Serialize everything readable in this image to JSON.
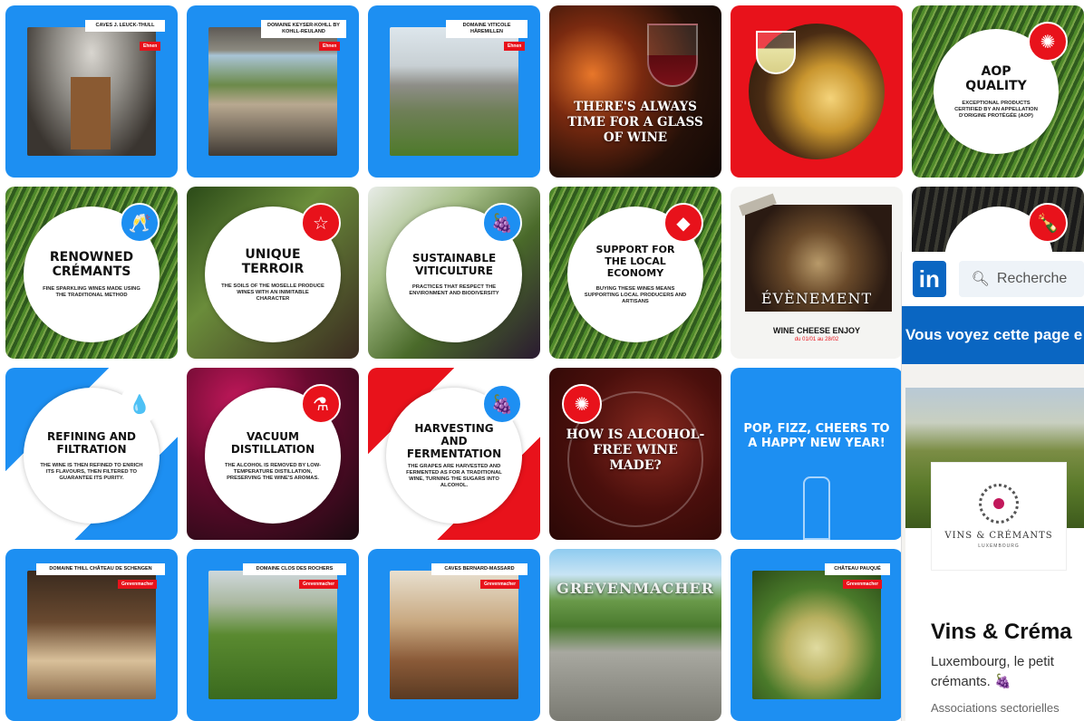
{
  "row1": {
    "t1": {
      "label": "CAVES J. LEUCK-THULL",
      "loc": "Ehnen"
    },
    "t2": {
      "label": "DOMAINE KEYSER-KOHLL BY KOHLL-REULAND",
      "loc": "Ehnen"
    },
    "t3": {
      "label": "DOMAINE VITICOLE HÄREMILLEN",
      "loc": "Ehnen"
    },
    "t4": {
      "text": "THERE'S ALWAYS TIME FOR A GLASS OF WINE"
    },
    "t6": {
      "title": "AOP QUALITY",
      "desc": "EXCEPTIONAL PRODUCTS CERTIFIED BY AN APPELLATION D'ORIGINE PROTÉGÉE (AOP)"
    }
  },
  "row2": {
    "t1": {
      "title": "RENOWNED CRÉMANTS",
      "desc": "FINE SPARKLING WINES MADE USING THE TRADITIONAL METHOD"
    },
    "t2": {
      "title": "UNIQUE TERROIR",
      "desc": "THE SOILS OF THE MOSELLE PRODUCE WINES WITH AN INIMITABLE CHARACTER"
    },
    "t3": {
      "title": "SUSTAINABLE VITICULTURE",
      "desc": "PRACTICES THAT RESPECT THE ENVIRONMENT AND BIODIVERSITY"
    },
    "t4": {
      "title": "SUPPORT FOR THE LOCAL ECONOMY",
      "desc": "BUYING THESE WINES MEANS SUPPORTING LOCAL PRODUCERS AND ARTISANS"
    },
    "t5": {
      "event": "ÉVÈNEMENT",
      "title": "WINE CHEESE ENJOY",
      "dates": "du 01/01 au 28/02"
    }
  },
  "row3": {
    "t1": {
      "title": "REFINING AND FILTRATION",
      "desc": "THE WINE IS THEN REFINED TO ENRICH ITS FLAVOURS, THEN FILTERED TO GUARANTEE ITS PURITY."
    },
    "t2": {
      "title": "VACUUM DISTILLATION",
      "desc": "THE ALCOHOL IS REMOVED BY LOW-TEMPERATURE DISTILLATION, PRESERVING THE WINE'S AROMAS."
    },
    "t3": {
      "title": "HARVESTING AND FERMENTATION",
      "desc": "THE GRAPES ARE HARVESTED AND FERMENTED AS FOR A TRADITIONAL WINE, TURNING THE SUGARS INTO ALCOHOL."
    },
    "t4": {
      "text": "HOW IS ALCOHOL-FREE WINE MADE?"
    },
    "t5": {
      "text": "POP, FIZZ, CHEERS TO A HAPPY NEW YEAR!"
    }
  },
  "row4": {
    "t1": {
      "label": "DOMAINE THILL CHÂTEAU DE SCHENGEN",
      "loc": "Grevenmacher"
    },
    "t2": {
      "label": "DOMAINE CLOS DES ROCHERS",
      "loc": "Grevenmacher"
    },
    "t3": {
      "label": "CAVES BERNARD-MASSARD",
      "loc": "Grevenmacher"
    },
    "t4": {
      "text": "GREVENMACHER"
    },
    "t5": {
      "label": "CHÂTEAU PAUQUÉ",
      "loc": "Grevenmacher"
    }
  },
  "linkedin": {
    "logo": "in",
    "search_placeholder": "Recherche",
    "banner": "Vous voyez cette page e",
    "org_logo_line1": "VINS & CRÉMANTS",
    "org_logo_line2": "LUXEMBOURG",
    "name": "Vins & Créma",
    "desc_line1": "Luxembourg, le petit",
    "desc_line2": "crémants. 🍇",
    "category": "Associations sectorielles"
  },
  "colors": {
    "blue": "#1d8ff2",
    "red": "#e8121b",
    "linkedin": "#0a66c2"
  }
}
